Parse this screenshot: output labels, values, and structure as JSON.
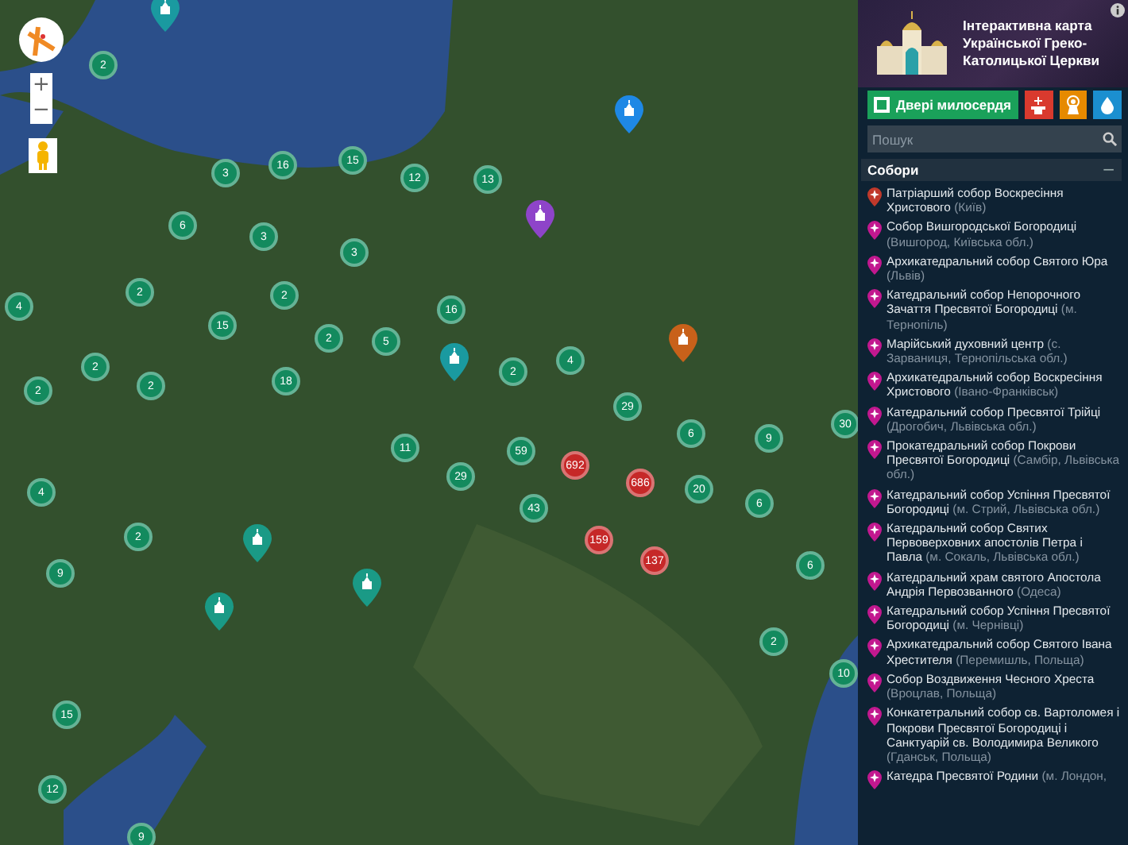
{
  "map": {
    "zoom_in": "+",
    "zoom_out": "−",
    "clusters": [
      {
        "count": "2",
        "color": "#138a5e"
      },
      {
        "count": "3",
        "color": "#138a5e"
      },
      {
        "count": "16",
        "color": "#138a5e"
      },
      {
        "count": "15",
        "color": "#138a5e"
      },
      {
        "count": "12",
        "color": "#138a5e"
      },
      {
        "count": "6",
        "color": "#138a5e"
      },
      {
        "count": "3",
        "color": "#138a5e"
      },
      {
        "count": "3",
        "color": "#138a5e"
      },
      {
        "count": "4",
        "color": "#138a5e"
      },
      {
        "count": "2",
        "color": "#138a5e"
      },
      {
        "count": "2",
        "color": "#138a5e"
      },
      {
        "count": "15",
        "color": "#138a5e"
      },
      {
        "count": "2",
        "color": "#138a5e"
      },
      {
        "count": "5",
        "color": "#138a5e"
      },
      {
        "count": "2",
        "color": "#138a5e"
      },
      {
        "count": "18",
        "color": "#138a5e"
      },
      {
        "count": "2",
        "color": "#138a5e"
      },
      {
        "count": "2",
        "color": "#138a5e"
      },
      {
        "count": "13",
        "color": "#138a5e"
      },
      {
        "count": "16",
        "color": "#138a5e"
      },
      {
        "count": "2",
        "color": "#138a5e"
      },
      {
        "count": "4",
        "color": "#138a5e"
      },
      {
        "count": "29",
        "color": "#138a5e"
      },
      {
        "count": "30",
        "color": "#138a5e"
      },
      {
        "count": "4",
        "color": "#138a5e"
      },
      {
        "count": "2",
        "color": "#138a5e"
      },
      {
        "count": "9",
        "color": "#138a5e"
      },
      {
        "count": "11",
        "color": "#138a5e"
      },
      {
        "count": "59",
        "color": "#138a5e"
      },
      {
        "count": "29",
        "color": "#138a5e"
      },
      {
        "count": "43",
        "color": "#138a5e"
      },
      {
        "count": "692",
        "color": "#c62828"
      },
      {
        "count": "686",
        "color": "#c62828"
      },
      {
        "count": "159",
        "color": "#c62828"
      },
      {
        "count": "137",
        "color": "#c62828"
      },
      {
        "count": "6",
        "color": "#138a5e"
      },
      {
        "count": "9",
        "color": "#138a5e"
      },
      {
        "count": "20",
        "color": "#138a5e"
      },
      {
        "count": "6",
        "color": "#138a5e"
      },
      {
        "count": "6",
        "color": "#138a5e"
      },
      {
        "count": "2",
        "color": "#138a5e"
      },
      {
        "count": "15",
        "color": "#138a5e"
      },
      {
        "count": "12",
        "color": "#138a5e"
      },
      {
        "count": "9",
        "color": "#138a5e"
      },
      {
        "count": "10",
        "color": "#138a5e"
      }
    ],
    "pins": [
      {
        "color": "#1a9aa0"
      },
      {
        "color": "#1e88e5"
      },
      {
        "color": "#8e44c9"
      },
      {
        "color": "#c8611a"
      },
      {
        "color": "#1a9aa0"
      },
      {
        "color": "#1a9a86"
      },
      {
        "color": "#1a9a86"
      },
      {
        "color": "#1a9a86"
      }
    ]
  },
  "sidebar": {
    "title": "Інтерактивна карта Української Греко-Католицької Церкви",
    "door_button": "Двері милосердя",
    "search": {
      "placeholder": "Пошук"
    },
    "section": {
      "title": "Собори",
      "toggle": "−",
      "expanded": true
    },
    "items": [
      {
        "kind": "patriarchal",
        "name": "Патріарший собор Воскресіння Христового",
        "place": "(Київ)"
      },
      {
        "kind": "cathedral",
        "name": "Собор Вишгородської Богородиці",
        "place": "(Вишгород, Київська обл.)"
      },
      {
        "kind": "cathedral",
        "name": "Архикатедральний собор Святого Юра",
        "place": "(Львів)"
      },
      {
        "kind": "cathedral",
        "name": "Катедральний собор Непорочного Зачаття Пресвятої Богородиці",
        "place": "(м. Тернопіль)"
      },
      {
        "kind": "cathedral",
        "name": "Марійський духовний центр",
        "place": "(с. Зарваниця, Тернопільська обл.)"
      },
      {
        "kind": "cathedral",
        "name": "Архикатедральний собор Воскресіння Христового",
        "place": "(Івано-Франківськ)"
      },
      {
        "kind": "cathedral",
        "name": "Катедральний собор Пресвятої Трійці",
        "place": "(Дрогобич, Львівська обл.)"
      },
      {
        "kind": "cathedral",
        "name": "Прокатедральний собор Покрови Пресвятої Богородиці",
        "place": "(Самбір, Львівська обл.)"
      },
      {
        "kind": "cathedral",
        "name": "Катедральний собор Успіння Пресвятої Богородиці",
        "place": "(м. Стрий, Львівська обл.)"
      },
      {
        "kind": "cathedral",
        "name": "Катедральний собор Святих Первоверховних апостолів Петра і Павла",
        "place": "(м. Сокаль, Львівська обл.)"
      },
      {
        "kind": "cathedral",
        "name": "Катедральний храм святого Апостола Андрія Первозванного",
        "place": "(Одеса)"
      },
      {
        "kind": "cathedral",
        "name": "Катедральний собор Успіння Пресвятої Богородиці",
        "place": "(м. Чернівці)"
      },
      {
        "kind": "cathedral",
        "name": "Архикатедральний собор Святого Івана Хрестителя",
        "place": "(Перемишль, Польща)"
      },
      {
        "kind": "cathedral",
        "name": "Собор Воздвиження Чесного Хреста",
        "place": "(Вроцлав, Польща)"
      },
      {
        "kind": "cathedral",
        "name": "Конкатетральний собор св. Вартоломея і Покрови Пресвятої Богородиці і Санктуарій св. Володимира Великого",
        "place": "(Гданськ, Польща)"
      },
      {
        "kind": "cathedral",
        "name": "Катедра Пресвятої Родини",
        "place": "(м. Лондон,"
      }
    ]
  }
}
